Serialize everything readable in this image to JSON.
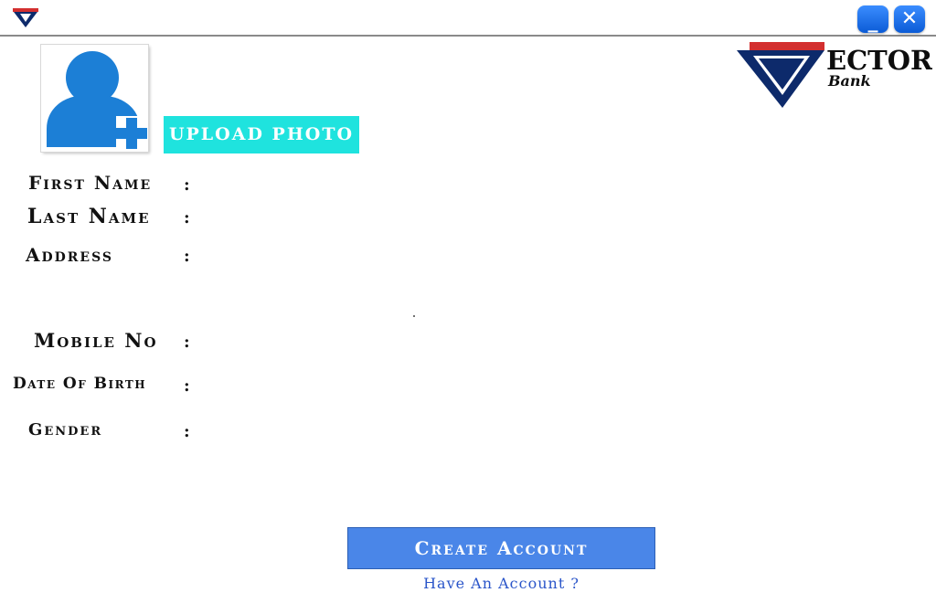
{
  "titlebar": {
    "app_icon": "vector-bank-v-icon",
    "minimize_icon": "minimize-icon",
    "close_icon": "close-icon",
    "close_glyph": "✕",
    "accent": "#1a6ff0"
  },
  "photo": {
    "icon": "add-user-icon",
    "upload_label": "UPLOAD PHOTO",
    "upload_color": "#1fe3de",
    "icon_color": "#1c7fd6"
  },
  "logo": {
    "word": "ECTOR",
    "sub": "Bank",
    "red": "#d32f2f",
    "navy": "#0d2a6b"
  },
  "form": {
    "first_name": "First Name",
    "last_name": "Last Name",
    "address": "Address",
    "mobile": "Mobile No",
    "dob": "Date Of Birth",
    "gender": "Gender",
    "colon": ":"
  },
  "actions": {
    "create_label": "Create Account",
    "have_account": "Have An Account ?",
    "button_color": "#4a86e8",
    "link_color": "#2a55c9"
  }
}
